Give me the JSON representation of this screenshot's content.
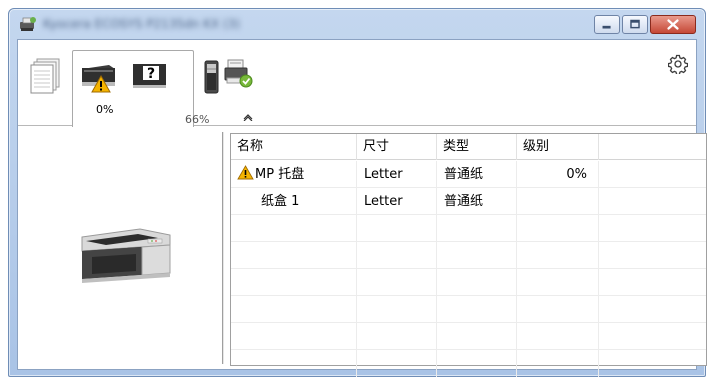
{
  "window": {
    "title": "Kyocera ECOSYS P2135dn KX (3)",
    "accent_colors": {
      "titlebar": "#b8cfec",
      "close_button": "#c54836",
      "warning": "#f5b400"
    }
  },
  "tabs": [
    {
      "icon": "document-stack-icon",
      "label": ""
    },
    {
      "icon": "paper-tray-warning-icon",
      "label": "0%",
      "selected": true
    },
    {
      "icon": "toner-cartridge-icon",
      "label": "66%"
    },
    {
      "icon": "printer-settings-check-icon",
      "label": ""
    }
  ],
  "table": {
    "columns": [
      "名称",
      "尺寸",
      "类型",
      "级别"
    ],
    "rows": [
      {
        "name": "MP 托盘",
        "size": "Letter",
        "type": "普通纸",
        "level": "0%",
        "warning": true
      },
      {
        "name": "纸盒 1",
        "size": "Letter",
        "type": "普通纸",
        "level": "",
        "warning": false
      }
    ],
    "empty_rows": 6
  }
}
